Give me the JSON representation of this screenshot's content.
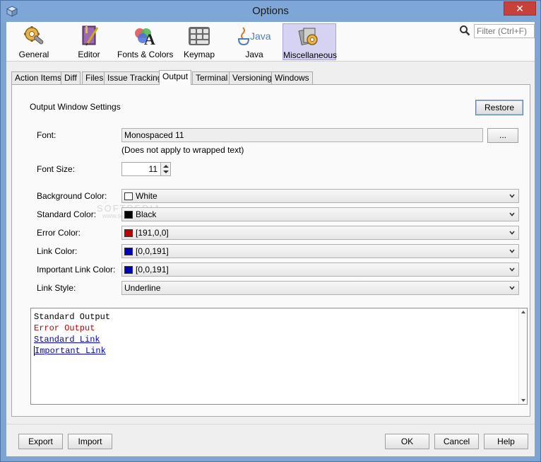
{
  "window": {
    "title": "Options",
    "close_glyph": "✕"
  },
  "toolbar": {
    "categories": [
      {
        "label": "General",
        "icon": "gear-wrench-icon"
      },
      {
        "label": "Editor",
        "icon": "book-pen-icon"
      },
      {
        "label": "Fonts & Colors",
        "icon": "fonts-colors-icon"
      },
      {
        "label": "Keymap",
        "icon": "keyboard-icon"
      },
      {
        "label": "Java",
        "icon": "java-icon"
      },
      {
        "label": "Miscellaneous",
        "icon": "miscellaneous-icon",
        "selected": true
      }
    ],
    "java_logo_text": "Java",
    "search_placeholder": "Filter (Ctrl+F)"
  },
  "tabs": [
    {
      "label": "Action Items"
    },
    {
      "label": "Diff"
    },
    {
      "label": "Files"
    },
    {
      "label": "Issue Tracking"
    },
    {
      "label": "Output",
      "selected": true
    },
    {
      "label": "Terminal"
    },
    {
      "label": "Versioning"
    },
    {
      "label": "Windows"
    }
  ],
  "output": {
    "section_title": "Output Window Settings",
    "restore_label": "Restore",
    "font_label": "Font:",
    "font_value": "Monospaced 11",
    "font_browse_label": "...",
    "font_note": "(Does not apply to wrapped text)",
    "font_size_label": "Font Size:",
    "font_size_value": "11",
    "fields": [
      {
        "label": "Background Color:",
        "value": "White",
        "swatch": "#ffffff"
      },
      {
        "label": "Standard Color:",
        "value": "Black",
        "swatch": "#000000"
      },
      {
        "label": "Error Color:",
        "value": "[191,0,0]",
        "swatch": "#bf0000"
      },
      {
        "label": "Link Color:",
        "value": "[0,0,191]",
        "swatch": "#0000bf"
      },
      {
        "label": "Important Link Color:",
        "value": "[0,0,191]",
        "swatch": "#0000bf"
      },
      {
        "label": "Link Style:",
        "value": "Underline",
        "swatch": null
      }
    ],
    "preview_lines": [
      {
        "text": "Standard Output",
        "color": "#000000",
        "underline": false
      },
      {
        "text": "Error Output",
        "color": "#bf0000",
        "underline": false
      },
      {
        "text": "Standard Link",
        "color": "#0000bf",
        "underline": true
      },
      {
        "text": "Important Link",
        "color": "#0000bf",
        "underline": true
      }
    ]
  },
  "buttons": {
    "export": "Export",
    "import": "Import",
    "ok": "OK",
    "cancel": "Cancel",
    "help": "Help"
  },
  "watermark": {
    "main": "SOFTPEDIA",
    "sub": "www.softpedia.com"
  }
}
